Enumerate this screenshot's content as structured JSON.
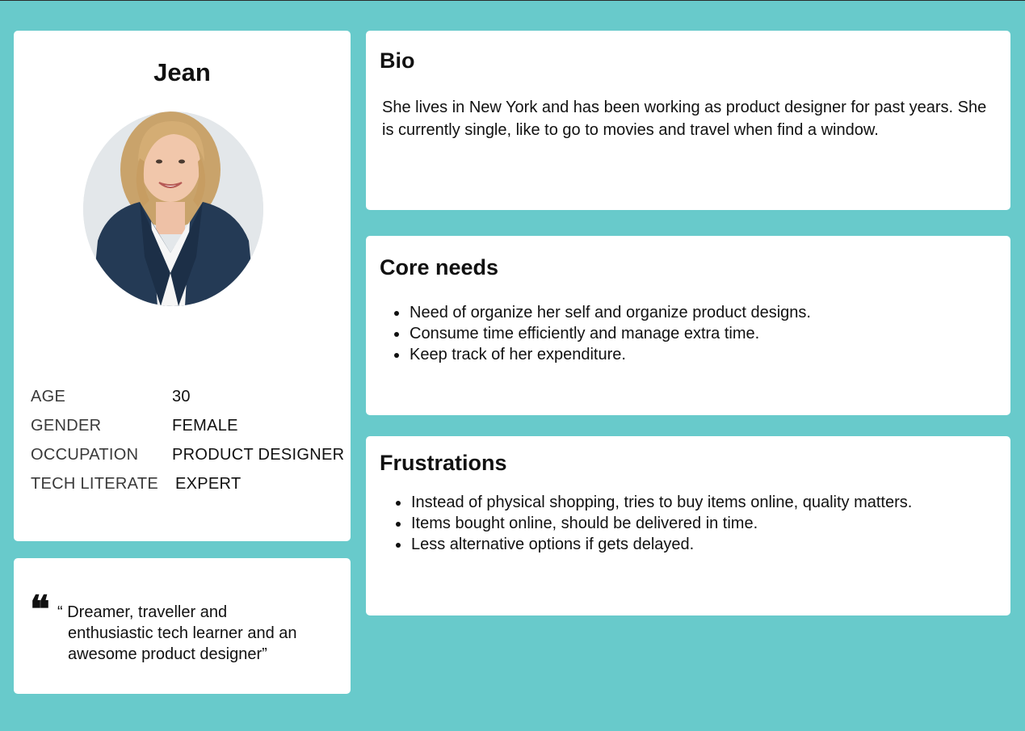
{
  "profile": {
    "name": "Jean",
    "photo_icon": "person-portrait-photo",
    "attributes": [
      {
        "label": "AGE",
        "value": "30"
      },
      {
        "label": "GENDER",
        "value": "FEMALE"
      },
      {
        "label": "OCCUPATION",
        "value": "PRODUCT DESIGNER"
      },
      {
        "label": "TECH LITERATE",
        "value": "EXPERT"
      }
    ]
  },
  "quote": {
    "icon": "quote-mark-icon",
    "line1": "“ Dreamer, traveller and",
    "line2": "enthusiastic tech learner and an",
    "line3": "awesome product designer”"
  },
  "bio": {
    "title": "Bio",
    "text": "She lives in New York and has been working as product designer for past years. She is currently single, like to go to movies and travel when find a window."
  },
  "core_needs": {
    "title": "Core needs",
    "items": [
      "Need of organize her self and organize product  designs.",
      "Consume time efficiently and manage extra time.",
      "Keep track of her expenditure."
    ]
  },
  "frustrations": {
    "title": "Frustrations",
    "items": [
      "Instead of physical shopping, tries to buy items online, quality matters.",
      "Items bought online, should be delivered in time.",
      "Less alternative options if gets delayed."
    ]
  },
  "colors": {
    "background": "#68CACB",
    "card": "#FFFFFF",
    "text": "#111111"
  }
}
